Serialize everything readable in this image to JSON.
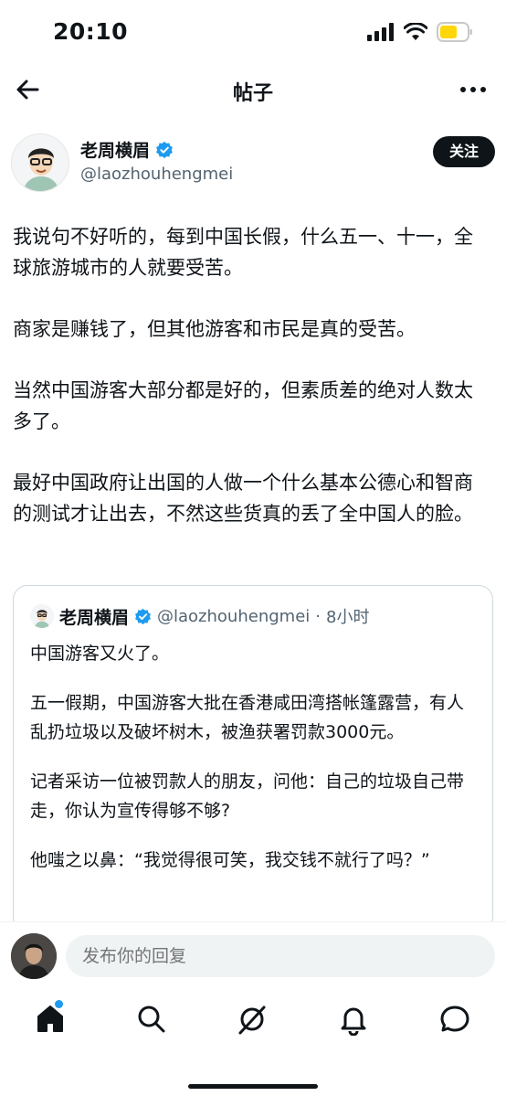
{
  "status": {
    "time": "20:10"
  },
  "nav": {
    "title": "帖子"
  },
  "author": {
    "name": "老周横眉",
    "handle": "@laozhouhengmei",
    "follow_label": "关注"
  },
  "post": {
    "paragraphs": [
      "我说句不好听的，每到中国长假，什么五一、十一，全球旅游城市的人就要受苦。",
      "商家是赚钱了，但其他游客和市民是真的受苦。",
      "当然中国游客大部分都是好的，但素质差的绝对人数太多了。",
      "最好中国政府让出国的人做一个什么基本公德心和智商的测试才让出去，不然这些货真的丢了全中国人的脸。"
    ]
  },
  "quote": {
    "name": "老周横眉",
    "handle": "@laozhouhengmei",
    "dot": "·",
    "time": "8小时",
    "paragraphs": [
      "中国游客又火了。",
      "五一假期，中国游客大批在香港咸田湾搭帐篷露营，有人乱扔垃圾以及破坏树木，被渔获署罚款3000元。",
      "记者采访一位被罚款人的朋友，问他：自己的垃圾自己带走，你认为宣传得够不够?",
      "他嗤之以鼻：“我觉得很可笑，我交钱不就行了吗？”"
    ]
  },
  "reply": {
    "placeholder": "发布你的回复"
  },
  "colors": {
    "accent": "#1d9bf0",
    "text": "#0f1419",
    "muted": "#536471",
    "battery": "#ffd60a"
  },
  "icons": [
    "back-arrow-icon",
    "more-icon",
    "verified-badge-icon",
    "home-icon",
    "search-icon",
    "grok-icon",
    "bell-icon",
    "messages-icon",
    "signal-icon",
    "wifi-icon",
    "battery-icon"
  ]
}
